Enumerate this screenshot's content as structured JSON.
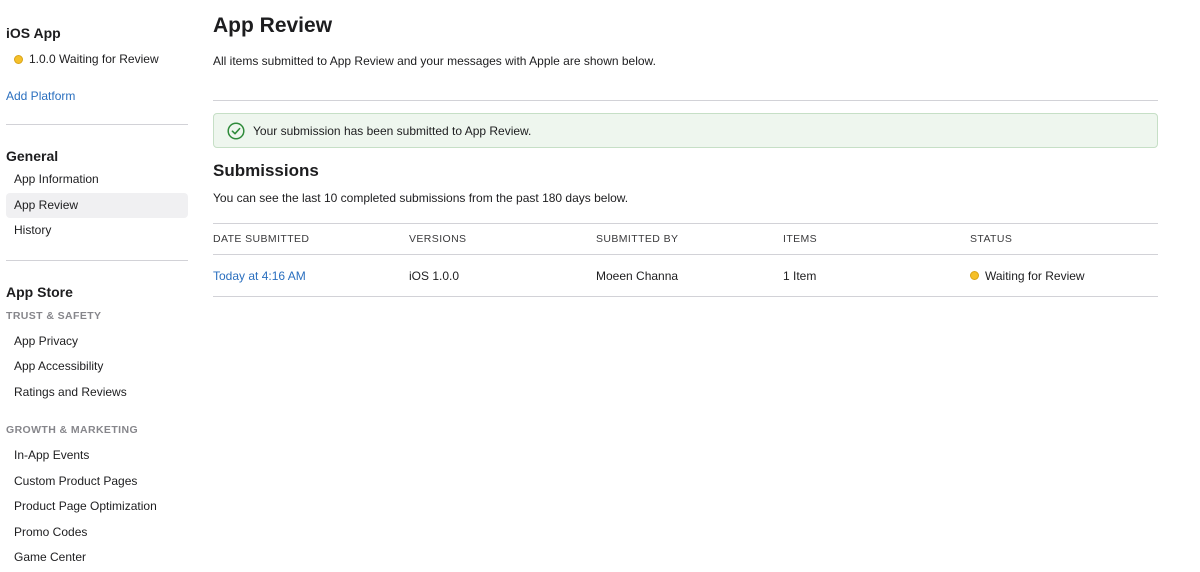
{
  "sidebar": {
    "app_title": "iOS App",
    "version_status": "1.0.0 Waiting for Review",
    "add_platform": "Add Platform",
    "general": {
      "heading": "General",
      "items": [
        {
          "label": "App Information"
        },
        {
          "label": "App Review",
          "active": true
        },
        {
          "label": "History"
        }
      ]
    },
    "app_store": {
      "heading": "App Store",
      "trust_safety": {
        "subheading": "TRUST & SAFETY",
        "items": [
          {
            "label": "App Privacy"
          },
          {
            "label": "App Accessibility"
          },
          {
            "label": "Ratings and Reviews"
          }
        ]
      },
      "growth_marketing": {
        "subheading": "GROWTH & MARKETING",
        "items": [
          {
            "label": "In-App Events"
          },
          {
            "label": "Custom Product Pages"
          },
          {
            "label": "Product Page Optimization"
          },
          {
            "label": "Promo Codes"
          },
          {
            "label": "Game Center"
          }
        ]
      }
    }
  },
  "main": {
    "title": "App Review",
    "description": "All items submitted to App Review and your messages with Apple are shown below.",
    "banner": {
      "icon": "checkmark-circle-icon",
      "text": "Your submission has been submitted to App Review."
    },
    "submissions": {
      "title": "Submissions",
      "description": "You can see the last 10 completed submissions from the past 180 days below.",
      "columns": [
        "DATE SUBMITTED",
        "VERSIONS",
        "SUBMITTED BY",
        "ITEMS",
        "STATUS"
      ],
      "rows": [
        {
          "date_submitted": "Today at 4:16 AM",
          "versions": "iOS 1.0.0",
          "submitted_by": "Moeen Channa",
          "items": "1 Item",
          "status": "Waiting for Review"
        }
      ]
    }
  },
  "colors": {
    "link": "#2a6fbf",
    "status_waiting": "#f5c02a",
    "banner_bg": "#eef6ee",
    "banner_border": "#c6dfc6",
    "success_icon": "#2e8b3a",
    "active_item_bg": "#f0f0f2"
  }
}
